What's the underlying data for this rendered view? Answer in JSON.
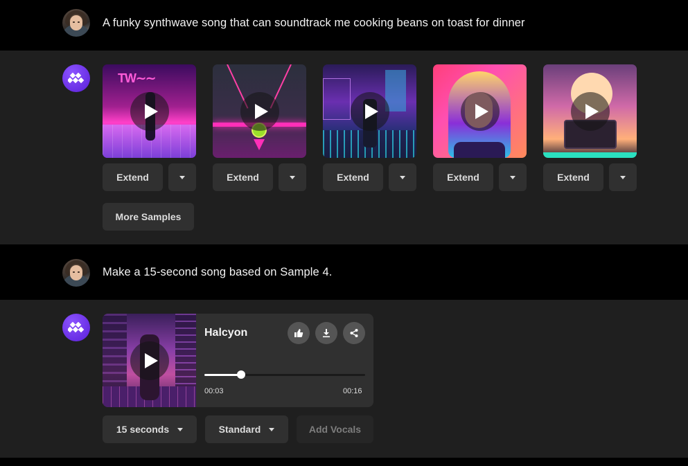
{
  "conversation": {
    "prompt1": "A funky synthwave song that can soundtrack me cooking beans on toast for dinner",
    "prompt2": "Make a 15-second song based on Sample 4."
  },
  "samples": [
    {
      "extend_label": "Extend",
      "icon": "play-icon"
    },
    {
      "extend_label": "Extend",
      "icon": "play-icon"
    },
    {
      "extend_label": "Extend",
      "icon": "play-icon"
    },
    {
      "extend_label": "Extend",
      "icon": "play-icon"
    },
    {
      "extend_label": "Extend",
      "icon": "play-icon"
    }
  ],
  "more_samples_label": "More Samples",
  "player": {
    "title": "Halcyon",
    "current_time": "00:03",
    "duration": "00:16",
    "progress": 0.23
  },
  "controls": {
    "duration_select": "15 seconds",
    "quality_select": "Standard",
    "add_vocals_label": "Add Vocals"
  },
  "colors": {
    "accent": "#6a2cf0",
    "button_bg": "#303030",
    "panel_bg": "#1f1f1f"
  }
}
